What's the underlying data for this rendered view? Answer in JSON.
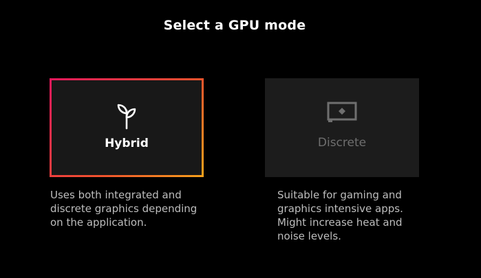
{
  "title": "Select a GPU mode",
  "modes": [
    {
      "label": "Hybrid",
      "icon": "plant-icon",
      "selected": true,
      "description": "Uses both integrated and\ndiscrete graphics depending\non the application."
    },
    {
      "label": "Discrete",
      "icon": "monitor-icon",
      "selected": false,
      "description": "Suitable for gaming and\ngraphics intensive apps.\nMight increase heat and\nnoise levels."
    }
  ],
  "colors": {
    "background": "#000000",
    "card_background": "#181818",
    "selected_border_start": "#e8175d",
    "selected_border_end": "#f7a21b",
    "disabled_text": "#6f6f6f",
    "description_text": "#bdbdbd"
  }
}
